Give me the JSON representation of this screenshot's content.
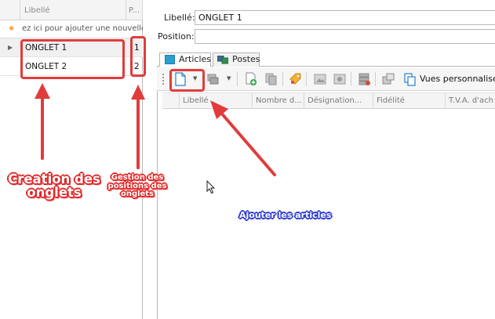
{
  "left_grid": {
    "header": {
      "libelle": "Libellé",
      "position": "P..."
    },
    "new_row_text": "ez ici pour ajouter une nouvelle",
    "rows": [
      {
        "libelle": "ONGLET 1",
        "position": "1"
      },
      {
        "libelle": "ONGLET 2",
        "position": "2"
      }
    ]
  },
  "form": {
    "libelle_label": "Libellé:",
    "libelle_value": "ONGLET 1",
    "position_label": "Position:",
    "position_value": ""
  },
  "tabs": [
    {
      "label": "Articles",
      "active": true
    },
    {
      "label": "Postes",
      "active": false
    }
  ],
  "toolbar": {
    "vues_label": "Vues personnalisé"
  },
  "columns": [
    "Libellé",
    "Nombre d...",
    "Désignation...",
    "Fidélité",
    "T.V.A. d'ach"
  ],
  "annotations": {
    "creation": "Creation des onglets",
    "gestion": "Gestion des positions des onglets",
    "ajouter": "Ajouter les articles"
  },
  "colors": {
    "annotation_red": "#e23b3b",
    "annotation_blue": "#2d3bd6",
    "tab_articles_icon": "#2a9fd1"
  },
  "icons": {
    "new_row": "asterisk-icon",
    "row_indicator": "row-pointer-icon",
    "articles_tab": "square-icon",
    "postes_tab": "monitor-icon"
  }
}
